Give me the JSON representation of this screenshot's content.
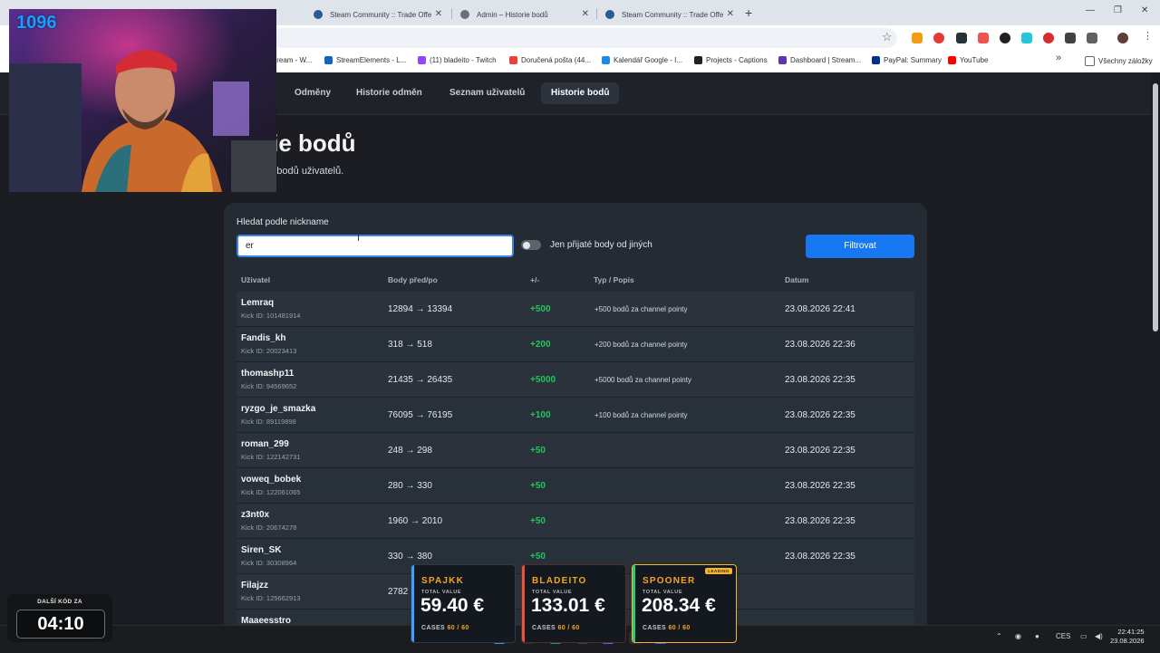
{
  "browser": {
    "tabs": [
      {
        "label": "Steam Community :: Trade Offe"
      },
      {
        "label": "Admin – Historie bodů"
      },
      {
        "label": "Steam Community :: Trade Offe"
      }
    ],
    "bookmarks": [
      {
        "label": "tream - W..."
      },
      {
        "label": "StreamElements - L..."
      },
      {
        "label": "(11) bladeito - Twitch"
      },
      {
        "label": "Doručená pošta (44..."
      },
      {
        "label": "Kalendář Google - I..."
      },
      {
        "label": "Projects - Captions"
      },
      {
        "label": "Dashboard | Stream..."
      },
      {
        "label": "PayPal: Summary"
      },
      {
        "label": "YouTube"
      }
    ],
    "all_bookmarks": "Všechny záložky"
  },
  "nav": {
    "items": [
      {
        "label": "Odměny"
      },
      {
        "label": "Historie odměn"
      },
      {
        "label": "Seznam uživatelů"
      },
      {
        "label": "Historie bodů"
      }
    ]
  },
  "page": {
    "title": "rie bodů",
    "subtitle": "ěn bodů uživatelů."
  },
  "filter": {
    "label": "Hledat podle nickname",
    "value": "er",
    "toggle_label": "Jen přijaté body od jiných",
    "toggle_on": false,
    "button": "Filtrovat"
  },
  "table": {
    "headers": {
      "user": "Uživatel",
      "points": "Body před/po",
      "delta": "+/-",
      "type": "Typ / Popis",
      "date": "Datum"
    },
    "rows": [
      {
        "user": "Lemraq",
        "kick": "Kick ID: 101481914",
        "points": "12894 → 13394",
        "delta": "+500",
        "desc": "+500 bodů za channel pointy",
        "date": "23.08.2026 22:41"
      },
      {
        "user": "Fandis_kh",
        "kick": "Kick ID: 20023413",
        "points": "318 → 518",
        "delta": "+200",
        "desc": "+200 bodů za channel pointy",
        "date": "23.08.2026 22:36"
      },
      {
        "user": "thomashp11",
        "kick": "Kick ID: 94569652",
        "points": "21435 → 26435",
        "delta": "+5000",
        "desc": "+5000 bodů za channel pointy",
        "date": "23.08.2026 22:35"
      },
      {
        "user": "ryzgo_je_smazka",
        "kick": "Kick ID: 89119898",
        "points": "76095 → 76195",
        "delta": "+100",
        "desc": "+100 bodů za channel pointy",
        "date": "23.08.2026 22:35"
      },
      {
        "user": "roman_299",
        "kick": "Kick ID: 122142731",
        "points": "248 → 298",
        "delta": "+50",
        "desc": "",
        "date": "23.08.2026 22:35"
      },
      {
        "user": "voweq_bobek",
        "kick": "Kick ID: 122061065",
        "points": "280 → 330",
        "delta": "+50",
        "desc": "",
        "date": "23.08.2026 22:35"
      },
      {
        "user": "z3nt0x",
        "kick": "Kick ID: 20674278",
        "points": "1960 → 2010",
        "delta": "+50",
        "desc": "",
        "date": "23.08.2026 22:35"
      },
      {
        "user": "Siren_SK",
        "kick": "Kick ID: 30308964",
        "points": "330 → 380",
        "delta": "+50",
        "desc": "",
        "date": "23.08.2026 22:35"
      },
      {
        "user": "Filajzz",
        "kick": "Kick ID: 125662913",
        "points": "2782",
        "delta": "",
        "desc": "",
        "date": ""
      },
      {
        "user": "Maaeesstro",
        "kick": "",
        "points": "",
        "delta": "",
        "desc": "",
        "date": ""
      }
    ]
  },
  "overlay": {
    "counter": "1096",
    "timer_label": "DALŠÍ KÓD ZA",
    "timer_value": "04:10",
    "leaderboard": [
      {
        "name": "SPAJKK",
        "total_label": "TOTAL VALUE",
        "amount": "59.40 €",
        "cases_label": "CASES",
        "cases": "60 / 60",
        "color": "#f5a524"
      },
      {
        "name": "BLADEITO",
        "total_label": "TOTAL VALUE",
        "amount": "133.01 €",
        "cases_label": "CASES",
        "cases": "60 / 60",
        "color": "#f5a524"
      },
      {
        "name": "SPOONER",
        "total_label": "TOTAL VALUE",
        "amount": "208.34 €",
        "cases_label": "CASES",
        "cases": "60 / 60",
        "color": "#f5a524",
        "badge": "LEADING"
      }
    ]
  },
  "taskbar": {
    "lang": "CES",
    "time": "22:41:25",
    "date": "23.08.2026"
  },
  "colors": {
    "accent": "#1877f2",
    "positive": "#22c55e",
    "counter": "#1a9dff",
    "gold": "#f5a524"
  }
}
